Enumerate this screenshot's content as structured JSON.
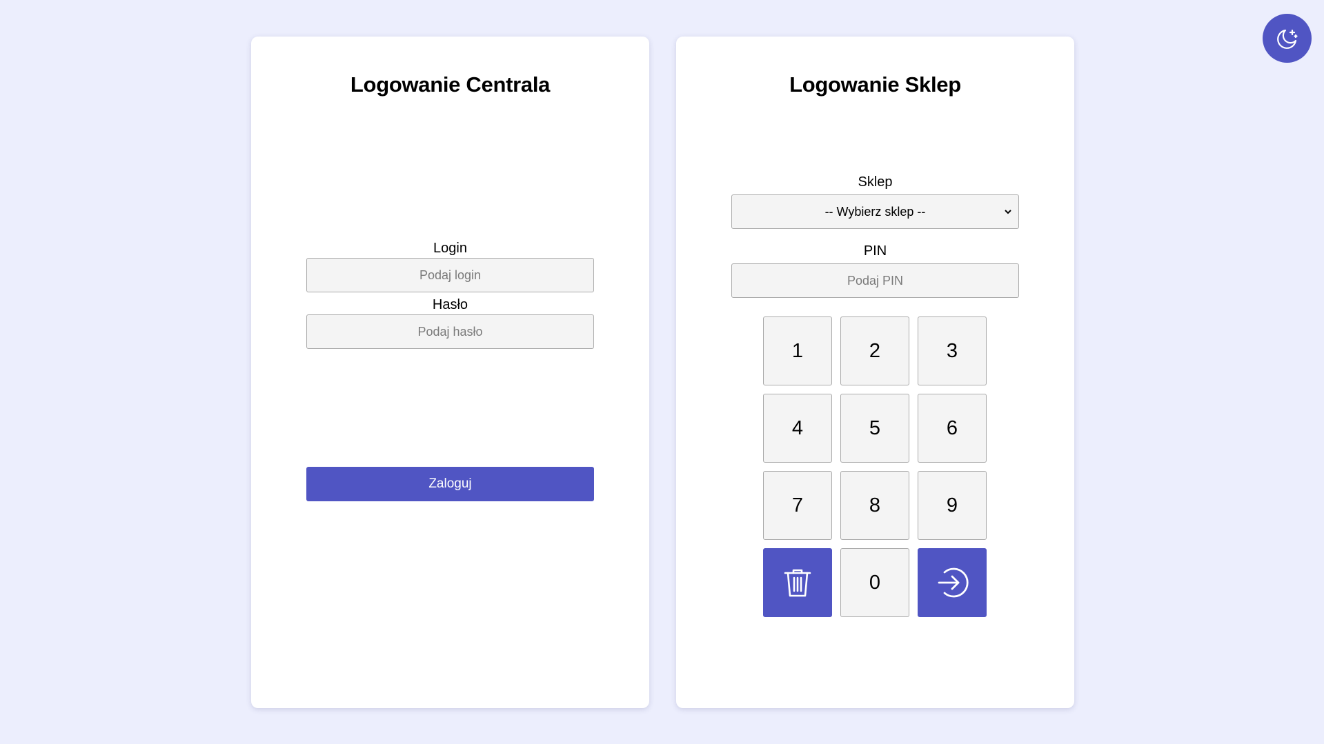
{
  "theme_toggle": {
    "icon": "moon-stars-icon"
  },
  "central_login": {
    "title": "Logowanie Centrala",
    "login_label": "Login",
    "login_placeholder": "Podaj login",
    "login_value": "",
    "password_label": "Hasło",
    "password_placeholder": "Podaj hasło",
    "password_value": "",
    "submit_label": "Zaloguj"
  },
  "shop_login": {
    "title": "Logowanie Sklep",
    "shop_label": "Sklep",
    "shop_selected": "-- Wybierz sklep --",
    "pin_label": "PIN",
    "pin_placeholder": "Podaj PIN",
    "pin_value": "",
    "keypad": {
      "keys": [
        "1",
        "2",
        "3",
        "4",
        "5",
        "6",
        "7",
        "8",
        "9",
        "0"
      ],
      "clear_icon": "trash-icon",
      "submit_icon": "login-arrow-icon"
    }
  },
  "colors": {
    "background": "#eceefd",
    "accent": "#5055c3",
    "input_bg": "#f4f4f4"
  }
}
